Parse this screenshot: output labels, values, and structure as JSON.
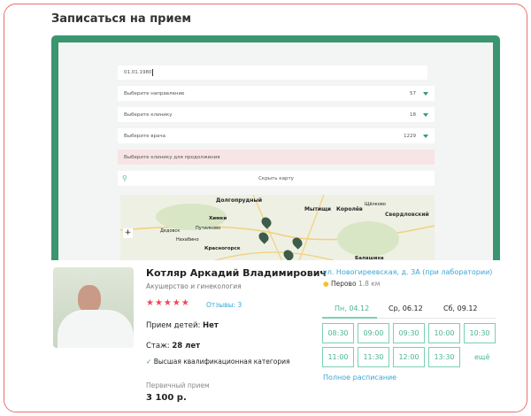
{
  "title": "Записаться на прием",
  "form": {
    "birthdate": "01.01.1980",
    "direction": {
      "placeholder": "Выберите направление",
      "count": "57"
    },
    "clinic": {
      "placeholder": "Выберите клинику",
      "count": "18"
    },
    "doctor": {
      "placeholder": "Выберите врача",
      "count": "1229"
    },
    "warning": "Выберите клинику для продолжения",
    "hide_map": "Скрыть карту"
  },
  "map": {
    "labels": [
      "Долгопрудный",
      "Мытищи",
      "Королёв",
      "Щёлково",
      "Химки",
      "Путилково",
      "Дедовск",
      "Нахабино",
      "Красногорск",
      "Балашиха",
      "Свердловский"
    ]
  },
  "doctor_card": {
    "name": "Котляр Аркадий Владимирович",
    "specialty": "Акушерство и гинекология",
    "rating": 5,
    "reviews": "Отзывы: 3",
    "children_label": "Прием детей:",
    "children_value": "Нет",
    "experience_label": "Стаж:",
    "experience_value": "28 лет",
    "category": "Высшая квалификационная категория",
    "price_label": "Первичный прием",
    "price": "3 100 р.",
    "address": "ул. Новогиреевская, д. 3А (при лаборатории)",
    "metro": "Перово",
    "distance": "1.8 км",
    "metro_color": "#f5c02c",
    "days": [
      "Пн, 04.12",
      "Ср, 06.12",
      "Сб, 09.12"
    ],
    "active_day": 0,
    "slots": [
      "08:30",
      "09:00",
      "09:30",
      "10:00",
      "10:30",
      "11:00",
      "11:30",
      "12:00",
      "13:30"
    ],
    "more": "ещё",
    "full_schedule": "Полное расписание"
  },
  "colors": {
    "accent": "#3b9670",
    "slot": "#4bb594",
    "link": "#3aa6d6",
    "star": "#f0475a",
    "border": "#ec6f6f"
  }
}
